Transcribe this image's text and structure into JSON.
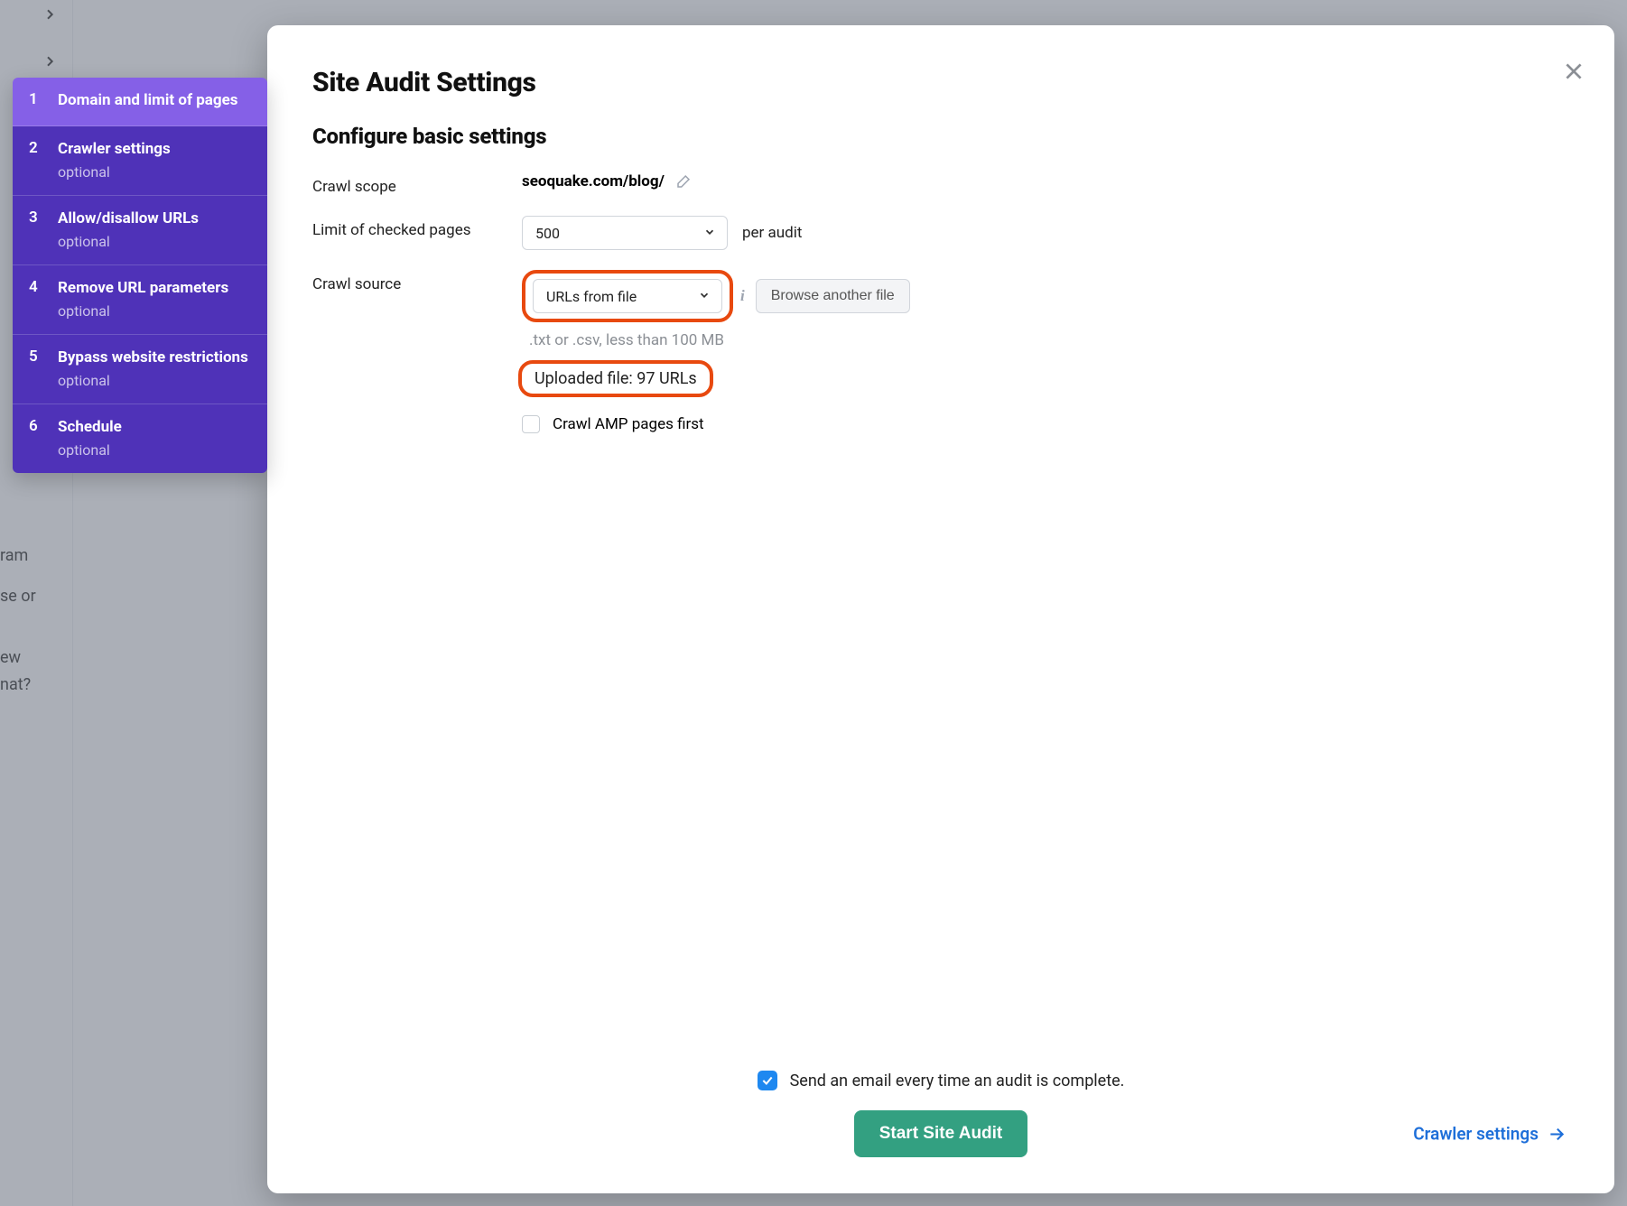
{
  "bg": {
    "t1": "ram",
    "t2": "se or",
    "t3": "ew",
    "t4": "nat?"
  },
  "wizard": {
    "steps": [
      {
        "num": "1",
        "title": "Domain and limit of pages",
        "optional": "",
        "active": true
      },
      {
        "num": "2",
        "title": "Crawler settings",
        "optional": "optional",
        "active": false
      },
      {
        "num": "3",
        "title": "Allow/disallow URLs",
        "optional": "optional",
        "active": false
      },
      {
        "num": "4",
        "title": "Remove URL parameters",
        "optional": "optional",
        "active": false
      },
      {
        "num": "5",
        "title": "Bypass website restrictions",
        "optional": "optional",
        "active": false
      },
      {
        "num": "6",
        "title": "Schedule",
        "optional": "optional",
        "active": false
      }
    ]
  },
  "modal": {
    "title": "Site Audit Settings",
    "subtitle": "Configure basic settings",
    "labels": {
      "crawl_scope": "Crawl scope",
      "limit": "Limit of checked pages",
      "crawl_source": "Crawl source"
    },
    "crawl_scope_value": "seoquake.com/blog/",
    "limit_value": "500",
    "per_audit": "per audit",
    "crawl_source_value": "URLs from file",
    "browse_btn": "Browse another file",
    "file_hint": ".txt or .csv, less than 100 MB",
    "uploaded": "Uploaded file: 97 URLs",
    "crawl_amp": "Crawl AMP pages first",
    "email_text": "Send an email every time an audit is complete.",
    "start_btn": "Start Site Audit",
    "crawler_link": "Crawler settings"
  }
}
